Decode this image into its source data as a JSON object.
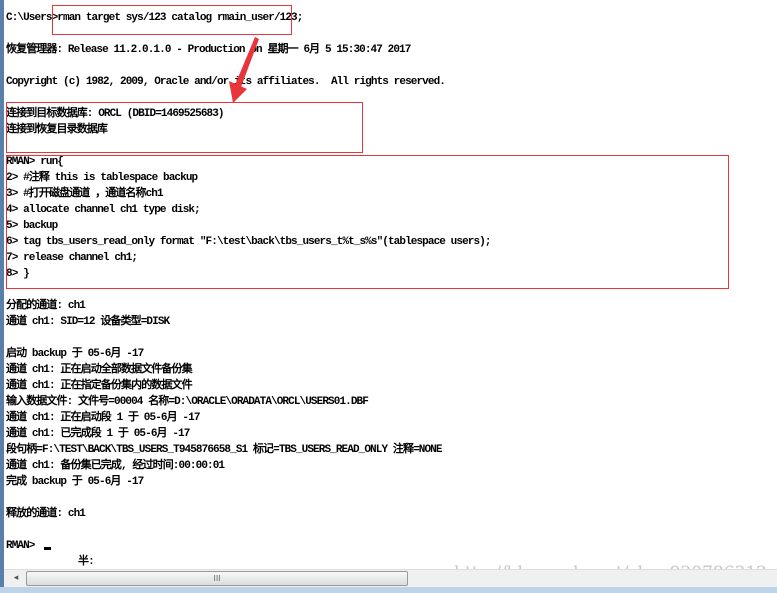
{
  "console": {
    "lines": [
      "C:\\Users>rman target sys/123 catalog rmain_user/123;",
      "",
      "恢复管理器: Release 11.2.0.1.0 - Production on 星期一 6月 5 15:30:47 2017",
      "",
      "Copyright (c) 1982, 2009, Oracle and/or its affiliates.  All rights reserved.",
      "",
      "连接到目标数据库: ORCL (DBID=1469525683)",
      "连接到恢复目录数据库",
      "",
      "RMAN> run{",
      "2> #注释 this is tablespace backup",
      "3> #打开磁盘通道 ，通道名称ch1",
      "4> allocate channel ch1 type disk;",
      "5> backup",
      "6> tag tbs_users_read_only format \"F:\\test\\back\\tbs_users_t%t_s%s\"(tablespace users);",
      "7> release channel ch1;",
      "8> }",
      "",
      "分配的通道: ch1",
      "通道 ch1: SID=12 设备类型=DISK",
      "",
      "启动 backup 于 05-6月 -17",
      "通道 ch1: 正在启动全部数据文件备份集",
      "通道 ch1: 正在指定备份集内的数据文件",
      "输入数据文件: 文件号=00004 名称=D:\\ORACLE\\ORADATA\\ORCL\\USERS01.DBF",
      "通道 ch1: 正在启动段 1 于 05-6月 -17",
      "通道 ch1: 已完成段 1 于 05-6月 -17",
      "段句柄=F:\\TEST\\BACK\\TBS_USERS_T945876658_S1 标记=TBS_USERS_READ_ONLY 注释=NONE",
      "通道 ch1: 备份集已完成, 经过时间:00:00:01",
      "完成 backup 于 05-6月 -17",
      "",
      "释放的通道: ch1",
      "",
      "RMAN> "
    ],
    "ime_status": "半:"
  },
  "watermark": "http://blog.csdn.net/zhou920786312",
  "colors": {
    "annotation": "#e8353b",
    "background": "#ffffff",
    "text": "#000000"
  },
  "scrollbar": {
    "left_arrow_icon": "◂",
    "grip_icon": "III"
  }
}
